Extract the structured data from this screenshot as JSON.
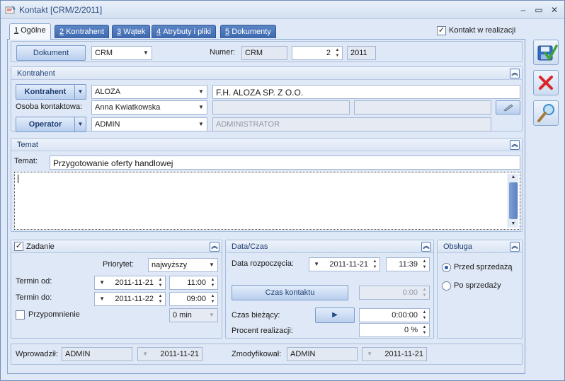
{
  "window": {
    "title": "Kontakt [CRM/2/2011]",
    "minimize_glyph": "–",
    "maximize_glyph": "▭",
    "close_glyph": "✕"
  },
  "tabs": [
    {
      "key": "1",
      "label": "Ogólne"
    },
    {
      "key": "2",
      "label": "Kontrahent"
    },
    {
      "key": "3",
      "label": "Wątek"
    },
    {
      "key": "4",
      "label": "Atrybuty i pliki"
    },
    {
      "key": "5",
      "label": "Dokumenty"
    }
  ],
  "in_progress": {
    "label": "Kontakt w realizacji",
    "checked": true,
    "mark": "✓"
  },
  "document": {
    "button_label": "Dokument",
    "type_value": "CRM",
    "number_label": "Numer:",
    "number_prefix": "CRM",
    "number_seq": "2",
    "number_year": "2011"
  },
  "contractor": {
    "section_title": "Kontrahent",
    "button_label": "Kontrahent",
    "code": "ALOZA",
    "name": "F.H. ALOZA SP. Z O.O.",
    "contact_person_label": "Osoba kontaktowa:",
    "contact_person": "Anna Kwiatkowska",
    "operator_button_label": "Operator",
    "operator_code": "ADMIN",
    "operator_name": "ADMINISTRATOR"
  },
  "subject": {
    "section_title": "Temat",
    "label": "Temat:",
    "value": "Przygotowanie oferty handlowej",
    "body": ""
  },
  "task": {
    "label": "Zadanie",
    "checked": true,
    "mark": "✓",
    "priority_label": "Priorytet:",
    "priority_value": "najwyższy",
    "from_label": "Termin od:",
    "from_date": "2011-11-21",
    "from_time": "11:00",
    "to_label": "Termin do:",
    "to_date": "2011-11-22",
    "to_time": "09:00",
    "reminder_label": "Przypomnienie",
    "reminder_value": "0 min"
  },
  "datetime": {
    "section_title": "Data/Czas",
    "start_label": "Data rozpoczęcia:",
    "start_date": "2011-11-21",
    "start_time": "11:39",
    "contact_time_button": "Czas kontaktu",
    "contact_time_value": "0:00",
    "current_time_label": "Czas bieżący:",
    "play_glyph": "▶",
    "current_time_value": "0:00:00",
    "progress_label": "Procent realizacji:",
    "progress_value": "0 %"
  },
  "service": {
    "section_title": "Obsługa",
    "options": [
      "Przed sprzedażą",
      "Po sprzedaży"
    ],
    "selected": "Przed sprzedażą"
  },
  "footer": {
    "entered_label": "Wprowadził:",
    "entered_by": "ADMIN",
    "entered_date": "2011-11-21",
    "modified_label": "Zmodyfikował:",
    "modified_by": "ADMIN",
    "modified_date": "2011-11-21"
  },
  "colors": {
    "accent": "#3d68ad",
    "panel": "#dfe8f6",
    "cancel_red": "#d9262a",
    "save_blue": "#2f6ec4"
  }
}
